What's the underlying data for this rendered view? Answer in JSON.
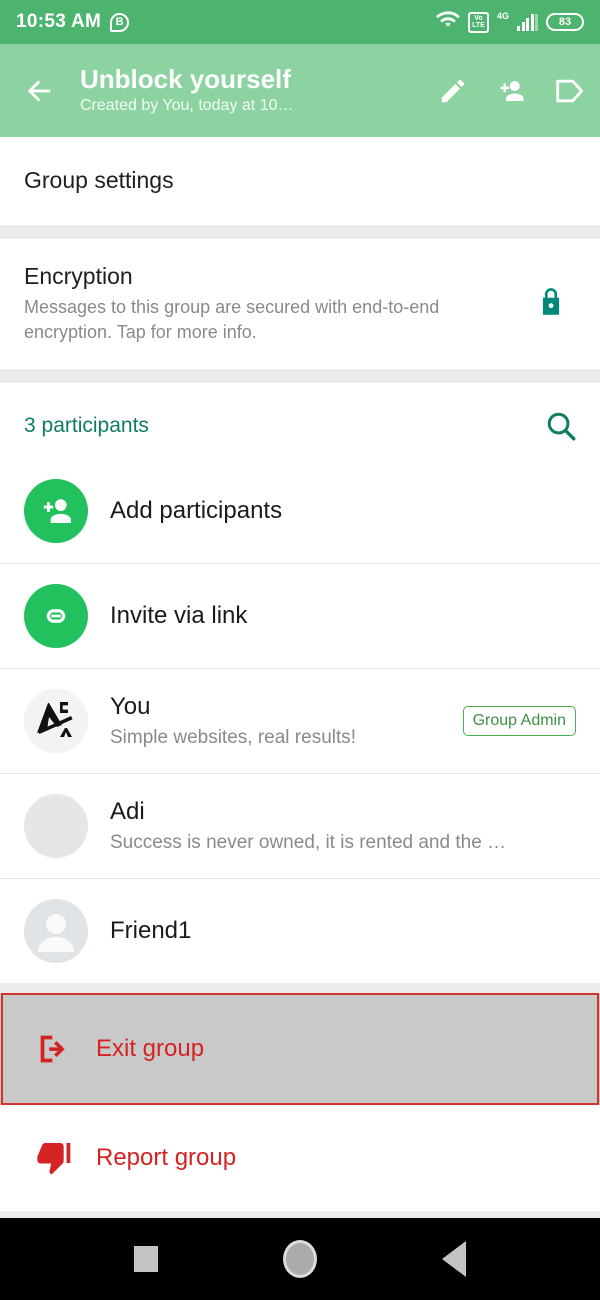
{
  "statusbar": {
    "time": "10:53 AM",
    "whatsapp_badge": "B",
    "volte_top": "Vo",
    "volte_bottom": "LTE",
    "network_type": "4G",
    "battery": "83",
    "icons": [
      "wifi-icon",
      "volte-icon",
      "signal-bars-icon",
      "battery-icon"
    ]
  },
  "appbar": {
    "back_icon": "back-arrow-icon",
    "title": "Unblock yourself",
    "subtitle": "Created by You, today at 10…",
    "actions": [
      {
        "name": "edit-group-icon",
        "label": "Edit"
      },
      {
        "name": "add-participant-icon",
        "label": "Add participant"
      },
      {
        "name": "label-tag-icon",
        "label": "Label"
      }
    ]
  },
  "group_settings": {
    "title": "Group settings"
  },
  "encryption": {
    "title": "Encryption",
    "description": "Messages to this group are secured with end-to-end encryption. Tap for more info.",
    "icon": "lock-icon",
    "icon_color": "#00897B"
  },
  "participants": {
    "count_label": "3 participants",
    "count_color": "#0F7D63",
    "search_icon": "search-icon",
    "actions": [
      {
        "label": "Add participants",
        "icon": "add-person-icon",
        "avatar_color": "#22C15E"
      },
      {
        "label": "Invite via link",
        "icon": "link-icon",
        "avatar_color": "#22C15E"
      }
    ],
    "members": [
      {
        "name": "You",
        "status": "Simple websites, real results!",
        "badge": "Group Admin",
        "avatar": "logo-avatar"
      },
      {
        "name": "Adi",
        "status": "Success is never owned, it is rented and the re…",
        "badge": "",
        "avatar": "photo-avatar"
      },
      {
        "name": "Friend1",
        "status": "",
        "badge": "",
        "avatar": "default-person-avatar"
      }
    ]
  },
  "destructive_actions": [
    {
      "label": "Exit group",
      "icon": "exit-icon",
      "color": "#D32323",
      "highlighted": true
    },
    {
      "label": "Report group",
      "icon": "thumbs-down-icon",
      "color": "#D32323",
      "highlighted": false
    }
  ],
  "navbar": {
    "recents": "recents-square-icon",
    "home": "home-circle-icon",
    "back": "back-triangle-icon"
  },
  "theme": {
    "statusbar_green": "#4CB46E",
    "appbar_green": "#8DD3A2",
    "accent_teal": "#0F7D63",
    "danger_red": "#D32323",
    "page_bg": "#ECECEC"
  }
}
